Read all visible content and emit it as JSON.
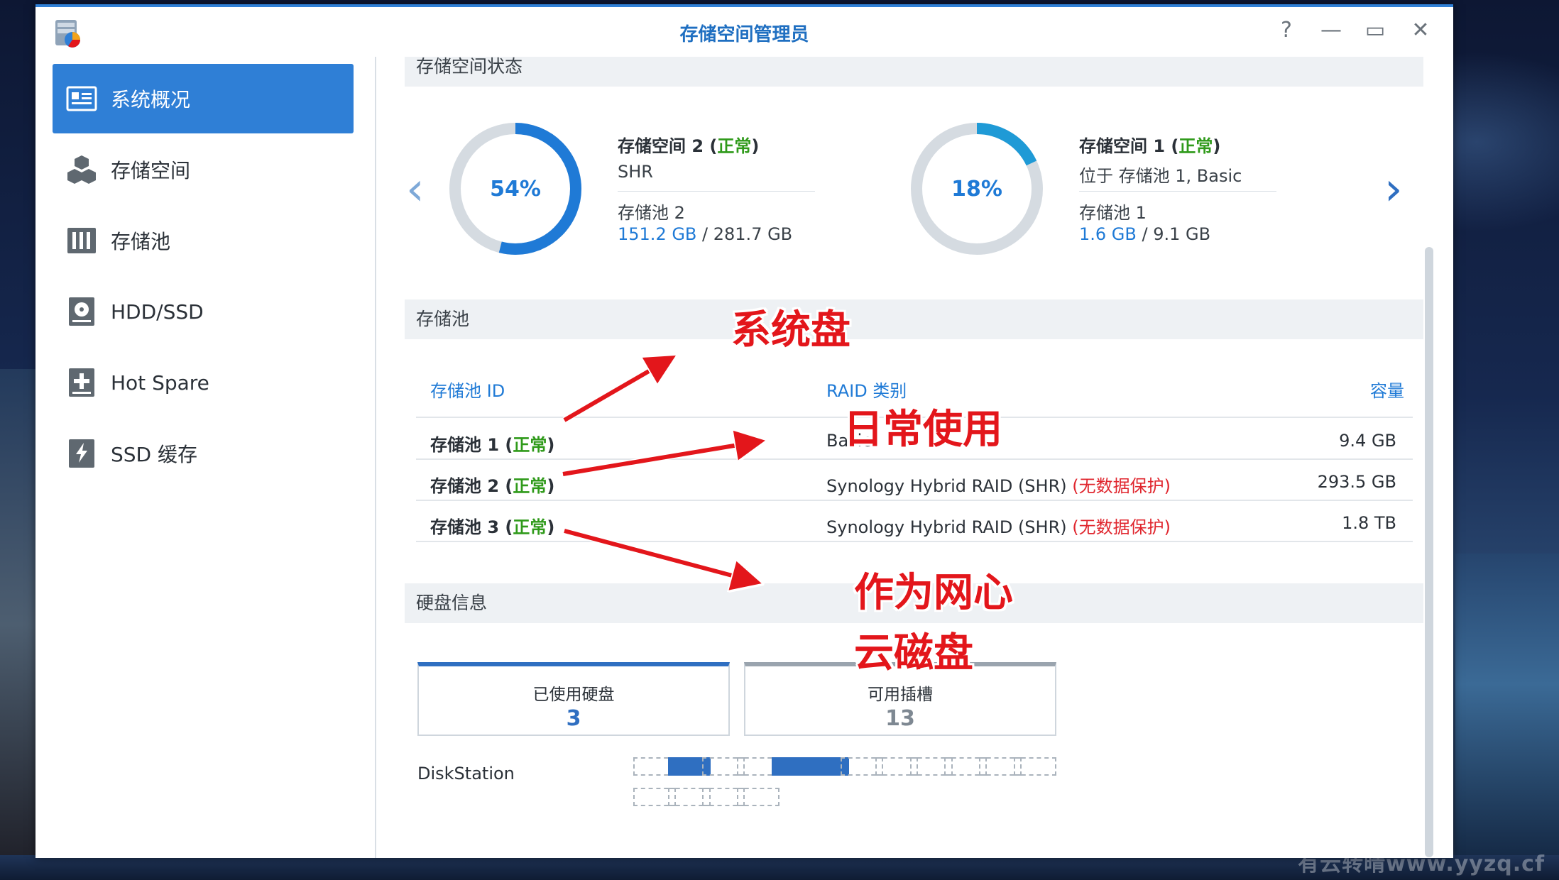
{
  "window": {
    "title": "存储空间管理员"
  },
  "sidebar": {
    "items": [
      {
        "label": "系统概况",
        "icon": "overview-icon",
        "active": true
      },
      {
        "label": "存储空间",
        "icon": "volume-icon",
        "active": false
      },
      {
        "label": "存储池",
        "icon": "storage-pool-icon",
        "active": false
      },
      {
        "label": "HDD/SSD",
        "icon": "hdd-icon",
        "active": false
      },
      {
        "label": "Hot Spare",
        "icon": "hot-spare-icon",
        "active": false
      },
      {
        "label": "SSD 缓存",
        "icon": "ssd-cache-icon",
        "active": false
      }
    ]
  },
  "volume_status": {
    "header": "存储空间状态",
    "volumes": [
      {
        "name": "存储空间 2",
        "status": "正常",
        "percent_label": "54%",
        "percent": 54,
        "type": "SHR",
        "pool": "存储池 2",
        "used": "151.2 GB",
        "total": "281.7 GB"
      },
      {
        "name": "存储空间 1",
        "status": "正常",
        "percent_label": "18%",
        "percent": 18,
        "type": "位于 存储池 1, Basic",
        "pool": "存储池 1",
        "used": "1.6 GB",
        "total": "9.1 GB"
      }
    ]
  },
  "storage_pool": {
    "header": "存储池",
    "columns": {
      "id": "存储池 ID",
      "raid": "RAID 类别",
      "capacity": "容量"
    },
    "rows": [
      {
        "id": "存储池 1",
        "status": "正常",
        "raid": "Basic",
        "warn": "",
        "capacity": "9.4 GB"
      },
      {
        "id": "存储池 2",
        "status": "正常",
        "raid": "Synology Hybrid RAID (SHR)",
        "warn": "(无数据保护)",
        "capacity": "293.5 GB"
      },
      {
        "id": "存储池 3",
        "status": "正常",
        "raid": "Synology Hybrid RAID (SHR)",
        "warn": "(无数据保护)",
        "capacity": "1.8 TB"
      }
    ]
  },
  "disk_info": {
    "header": "硬盘信息",
    "used_label": "已使用硬盘",
    "used_value": "3",
    "free_label": "可用插槽",
    "free_value": "13",
    "device": "DiskStation",
    "slots": [
      0,
      1,
      0,
      0,
      1,
      1,
      0,
      0,
      0,
      0,
      0,
      0,
      0,
      0,
      0,
      0
    ]
  },
  "annotations": {
    "system": "系统盘",
    "daily": "日常使用",
    "cloud1": "作为网心",
    "cloud2": "云磁盘"
  },
  "watermark": "有云转晴www.yyzq.cf",
  "colors": {
    "accent": "#2f7fd6",
    "ok": "#2f9a1a",
    "warn": "#e0262e"
  }
}
